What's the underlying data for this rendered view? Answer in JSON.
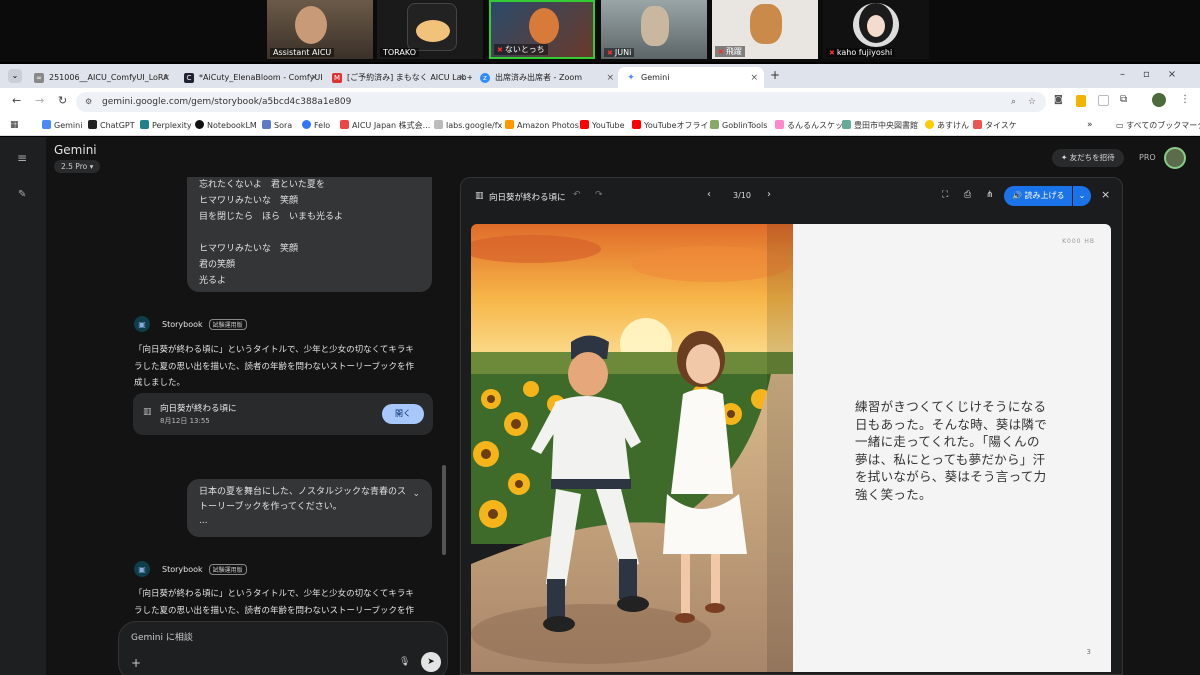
{
  "zoom": {
    "participants": [
      {
        "name": "Assistant AICU",
        "mic_off": false
      },
      {
        "name": "TORAKO",
        "mic_off": false
      },
      {
        "name": "ないとっち",
        "mic_off": true
      },
      {
        "name": "JUNi",
        "mic_off": true
      },
      {
        "name": "飛躍",
        "mic_off": true
      },
      {
        "name": "kaho fujiyoshi",
        "mic_off": true
      }
    ]
  },
  "browser": {
    "tabs": [
      {
        "title": "251006__AICU_ComfyUI_LoRA"
      },
      {
        "title": "*AiCuty_ElenaBloom - ComfyUI"
      },
      {
        "title": "[ご予約済み] まもなく AICU Lab+"
      },
      {
        "title": "出席済み出席者 - Zoom"
      },
      {
        "title": "Gemini"
      }
    ],
    "url": "gemini.google.com/gem/storybook/a5bcd4c388a1e809",
    "bookmarks": [
      "Gemini",
      "ChatGPT",
      "Perplexity",
      "NotebookLM",
      "Sora",
      "Felo",
      "AICU Japan 株式会...",
      "labs.google/fx",
      "Amazon Photos",
      "YouTube",
      "YouTubeオフライン",
      "GoblinTools",
      "るんるんスケッチ",
      "豊田市中央図書館",
      "あすけん",
      "タイスケ"
    ],
    "all_bookmarks": "すべてのブックマーク"
  },
  "gemini": {
    "title": "Gemini",
    "model": "2.5 Pro",
    "invite": "友だちを招待",
    "pro": "PRO",
    "bubble1": [
      "忘れたくないよ　君といた夏を",
      "ヒマワリみたいな　笑顔",
      "目を閉じたら　ほら　いまも光るよ",
      "",
      "ヒマワリみたいな　笑顔",
      "君の笑顔",
      "光るよ"
    ],
    "storybook_label": "Storybook",
    "storybook_badge": "試験運用版",
    "response1": [
      "「向日葵が終わる頃に」というタイトルで、少年と少女の切なくてキラキ",
      "ラした夏の思い出を描いた、読者の年齢を問わないストーリーブックを作",
      "成しました。"
    ],
    "card": {
      "title": "向日葵が終わる頃に",
      "date": "8月12日 13:55",
      "button": "開く"
    },
    "bubble2": [
      "日本の夏を舞台にした、ノスタルジックな青春のス",
      "トーリーブックを作ってください。",
      "..."
    ],
    "response2": [
      "「向日葵が終わる頃に」というタイトルで、少年と少女の切なくてキラキ",
      "ラした夏の思い出を描いた、読者の年齢を問わないストーリーブックを作"
    ],
    "input_placeholder": "Gemini に相談"
  },
  "viewer": {
    "title": "向日葵が終わる頃に",
    "page": "3/10",
    "read_aloud": "読み上げる",
    "corner_mark": "K000 HB",
    "page_number": "3",
    "text": [
      "練習がきつくてくじけそうになる",
      "日もあった。そんな時、葵は隣で",
      "一緒に走ってくれた。「陽くんの",
      "夢は、私にとっても夢だから」汗",
      "を拭いながら、葵はそう言って力",
      "強く笑った。"
    ]
  }
}
